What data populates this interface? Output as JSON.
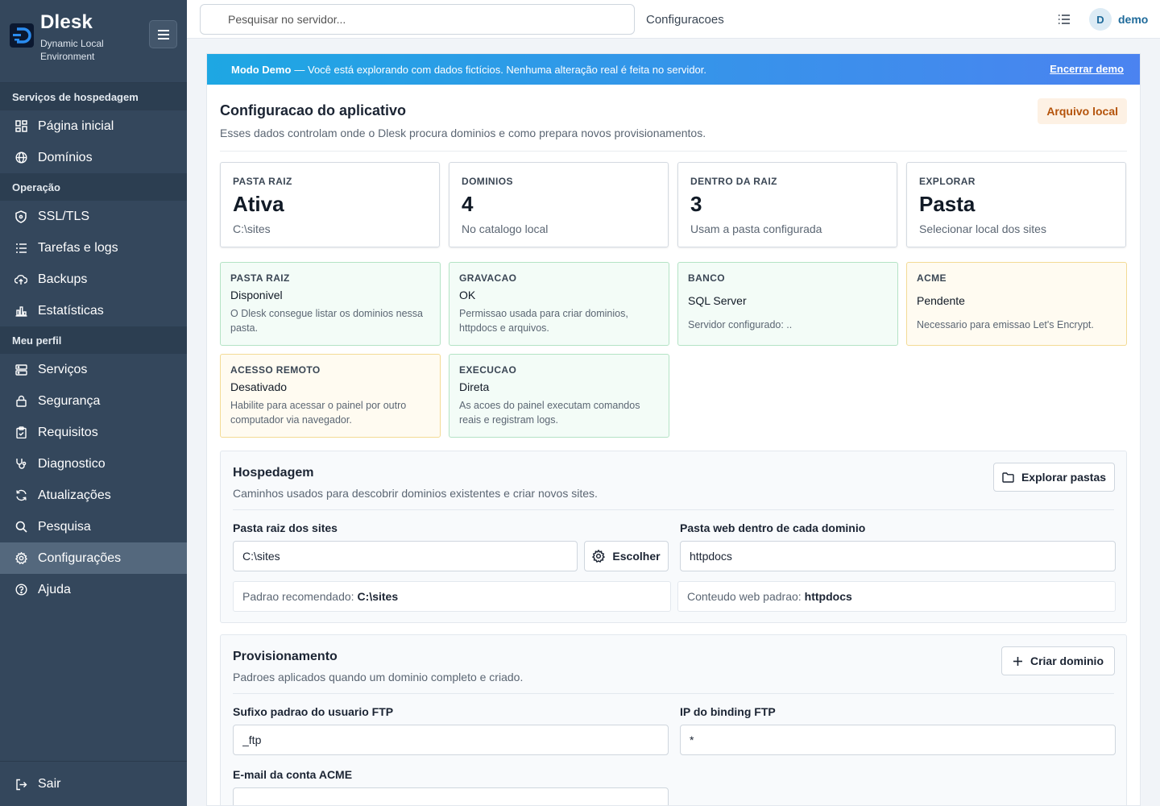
{
  "brand": {
    "name": "Dlesk",
    "subtitle": "Dynamic Local Environment"
  },
  "sidebar": {
    "sections": [
      {
        "title": "Serviços de hospedagem",
        "items": [
          {
            "label": "Página inicial",
            "icon": "dashboard-icon"
          },
          {
            "label": "Domínios",
            "icon": "globe-icon"
          }
        ]
      },
      {
        "title": "Operação",
        "items": [
          {
            "label": "SSL/TLS",
            "icon": "shield-icon"
          },
          {
            "label": "Tarefas e logs",
            "icon": "tasks-icon"
          },
          {
            "label": "Backups",
            "icon": "cloud-upload-icon"
          },
          {
            "label": "Estatísticas",
            "icon": "bar-chart-icon"
          }
        ]
      },
      {
        "title": "Meu perfil",
        "items": [
          {
            "label": "Serviços",
            "icon": "server-icon"
          },
          {
            "label": "Segurança",
            "icon": "lock-icon"
          },
          {
            "label": "Requisitos",
            "icon": "clipboard-icon"
          },
          {
            "label": "Diagnostico",
            "icon": "stethoscope-icon"
          },
          {
            "label": "Atualizações",
            "icon": "refresh-icon"
          },
          {
            "label": "Pesquisa",
            "icon": "search-icon"
          },
          {
            "label": "Configurações",
            "icon": "gear-icon",
            "active": true
          },
          {
            "label": "Ajuda",
            "icon": "help-icon"
          }
        ]
      }
    ],
    "logout": "Sair"
  },
  "topbar": {
    "search_placeholder": "Pesquisar no servidor...",
    "breadcrumb": "Configuracoes",
    "avatar_initial": "D",
    "user": "demo"
  },
  "demo_banner": {
    "title": "Modo Demo",
    "text": "— Você está explorando com dados fictícios. Nenhuma alteração real é feita no servidor.",
    "action": "Encerrar demo"
  },
  "page": {
    "title": "Configuracao do aplicativo",
    "subtitle": "Esses dados controlam onde o Dlesk procura dominios e como prepara novos provisionamentos.",
    "badge": "Arquivo local"
  },
  "stats": [
    {
      "label": "PASTA RAIZ",
      "value": "Ativa",
      "sub": "C:\\sites"
    },
    {
      "label": "DOMINIOS",
      "value": "4",
      "sub": "No catalogo local"
    },
    {
      "label": "DENTRO DA RAIZ",
      "value": "3",
      "sub": "Usam a pasta configurada"
    },
    {
      "label": "EXPLORAR",
      "value": "Pasta",
      "sub": "Selecionar local dos sites"
    }
  ],
  "checks": [
    {
      "label": "PASTA RAIZ",
      "value": "Disponivel",
      "desc": "O Dlesk consegue listar os dominios nessa pasta.",
      "status": "green"
    },
    {
      "label": "GRAVACAO",
      "value": "OK",
      "desc": "Permissao usada para criar dominios, httpdocs e arquivos.",
      "status": "green"
    },
    {
      "label": "BANCO",
      "value": "SQL Server",
      "desc": "Servidor configurado: ..",
      "status": "green"
    },
    {
      "label": "ACME",
      "value": "Pendente",
      "desc": "Necessario para emissao Let's Encrypt.",
      "status": "yellow"
    },
    {
      "label": "ACESSO REMOTO",
      "value": "Desativado",
      "desc": "Habilite para acessar o painel por outro computador via navegador.",
      "status": "yellow"
    },
    {
      "label": "EXECUCAO",
      "value": "Direta",
      "desc": "As acoes do painel executam comandos reais e registram logs.",
      "status": "green"
    }
  ],
  "hosting": {
    "title": "Hospedagem",
    "subtitle": "Caminhos usados para descobrir dominios existentes e criar novos sites.",
    "explore_button": "Explorar pastas",
    "root_label": "Pasta raiz dos sites",
    "root_value": "C:\\sites",
    "choose_button": "Escolher",
    "root_hint_prefix": "Padrao recomendado:",
    "root_hint_value": "C:\\sites",
    "web_label": "Pasta web dentro de cada dominio",
    "web_value": "httpdocs",
    "web_hint_prefix": "Conteudo web padrao:",
    "web_hint_value": "httpdocs"
  },
  "provisioning": {
    "title": "Provisionamento",
    "subtitle": "Padroes aplicados quando um dominio completo e criado.",
    "create_button": "Criar dominio",
    "ftp_suffix_label": "Sufixo padrao do usuario FTP",
    "ftp_suffix_value": "_ftp",
    "ftp_ip_label": "IP do binding FTP",
    "ftp_ip_value": "*",
    "acme_email_label": "E-mail da conta ACME",
    "acme_email_value": ""
  },
  "colors": {
    "sidebar": "#34475c",
    "accent": "#1e6a9a",
    "banner_start": "#1ea7e3",
    "banner_end": "#4b83f0"
  }
}
